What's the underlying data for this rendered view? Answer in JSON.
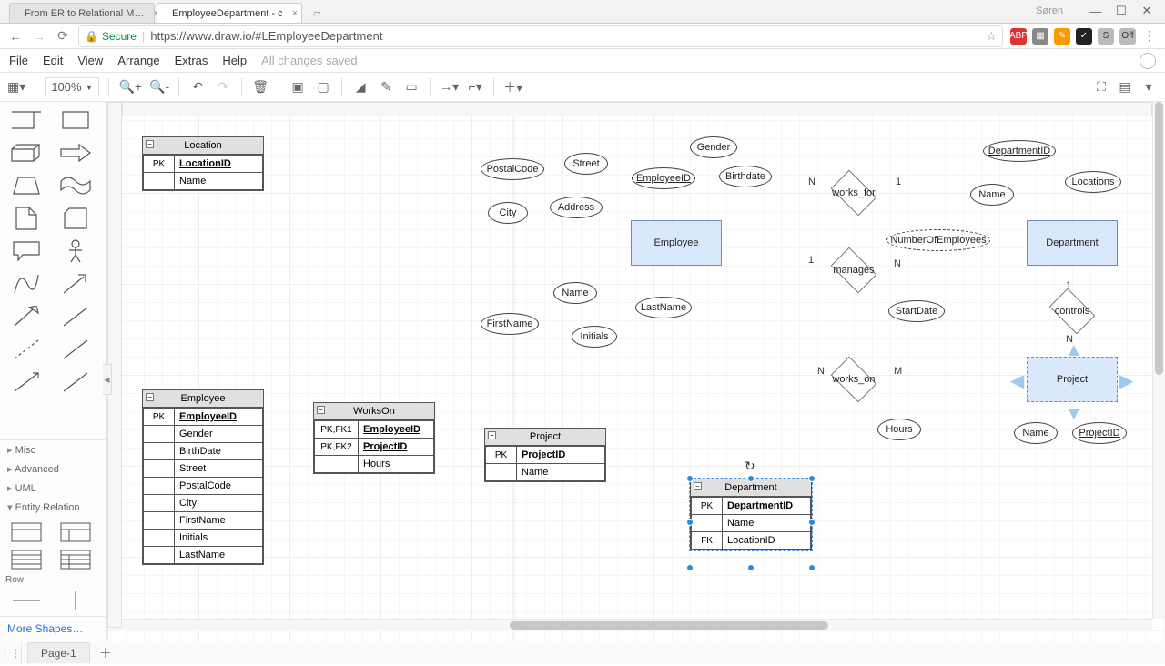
{
  "browser": {
    "tabs": [
      {
        "title": "From ER to Relational M…"
      },
      {
        "title": "EmployeeDepartment - c"
      }
    ],
    "user": "Søren",
    "url": "https://www.draw.io/#LEmployeeDepartment",
    "secure_label": "Secure"
  },
  "menu": {
    "items": [
      "File",
      "Edit",
      "View",
      "Arrange",
      "Extras",
      "Help"
    ],
    "saved": "All changes saved"
  },
  "toolbar": {
    "zoom": "100%"
  },
  "sidebar": {
    "sections": [
      "Misc",
      "Advanced",
      "UML",
      "Entity Relation"
    ],
    "row": "Row",
    "more": "More Shapes…"
  },
  "er": {
    "entities": {
      "employee": "Employee",
      "department": "Department",
      "project": "Project"
    },
    "relationships": {
      "works_for": "works_for",
      "manages": "manages",
      "works_on": "works_on",
      "controls": "controls"
    },
    "attributes": {
      "gender": "Gender",
      "birthdate": "Birthdate",
      "employeeid": "EmployeeID",
      "address": "Address",
      "street": "Street",
      "postalcode": "PostalCode",
      "city": "City",
      "name_emp": "Name",
      "firstname": "FirstName",
      "lastname": "LastName",
      "initials": "Initials",
      "departmentid": "DepartmentID",
      "locations": "Locations",
      "name_dept": "Name",
      "numemployees": "NumberOfEmployees",
      "startdate": "StartDate",
      "hours": "Hours",
      "name_proj": "Name",
      "projectid": "ProjectID"
    },
    "cards": {
      "wf_emp": "N",
      "wf_dept": "1",
      "mg_emp": "1",
      "mg_dept": "N",
      "wo_emp": "N",
      "wo_proj": "M",
      "ct_dept": "1",
      "ct_proj": "N"
    }
  },
  "tables": {
    "location": {
      "name": "Location",
      "rows": [
        {
          "key": "PK",
          "col": "LocationID",
          "pk": true
        },
        {
          "key": "",
          "col": "Name"
        }
      ]
    },
    "employee": {
      "name": "Employee",
      "rows": [
        {
          "key": "PK",
          "col": "EmployeeID",
          "pk": true
        },
        {
          "key": "",
          "col": "Gender"
        },
        {
          "key": "",
          "col": "BirthDate"
        },
        {
          "key": "",
          "col": "Street"
        },
        {
          "key": "",
          "col": "PostalCode"
        },
        {
          "key": "",
          "col": "City"
        },
        {
          "key": "",
          "col": "FirstName"
        },
        {
          "key": "",
          "col": "Initials"
        },
        {
          "key": "",
          "col": "LastName"
        }
      ]
    },
    "workson": {
      "name": "WorksOn",
      "rows": [
        {
          "key": "PK,FK1",
          "col": "EmployeeID",
          "pk": true
        },
        {
          "key": "PK,FK2",
          "col": "ProjectID",
          "pk": true
        },
        {
          "key": "",
          "col": "Hours"
        }
      ]
    },
    "project": {
      "name": "Project",
      "rows": [
        {
          "key": "PK",
          "col": "ProjectID",
          "pk": true
        },
        {
          "key": "",
          "col": "Name"
        }
      ]
    },
    "department": {
      "name": "Department",
      "rows": [
        {
          "key": "PK",
          "col": "DepartmentID",
          "pk": true
        },
        {
          "key": "",
          "col": "Name"
        },
        {
          "key": "FK",
          "col": "LocationID"
        }
      ]
    }
  },
  "footer": {
    "page": "Page-1"
  }
}
